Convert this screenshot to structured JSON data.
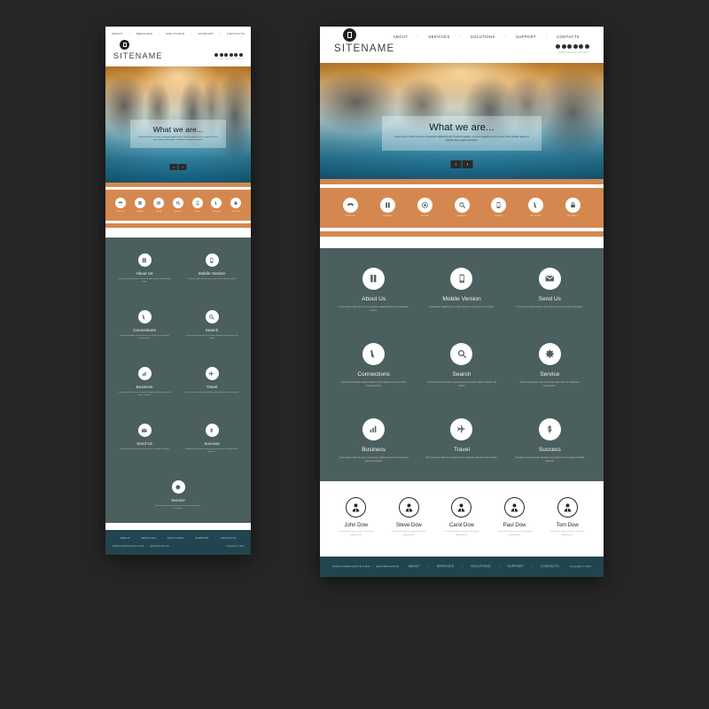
{
  "brand": {
    "name": "SITENAME",
    "logo_icon": "square-logo-icon",
    "tagline": "WEB DESIGN STUDIO"
  },
  "colors": {
    "orange": "#d4884f",
    "teal": "#4a5f5e",
    "footer": "#21454f",
    "page_bg": "#262626"
  },
  "topnav": {
    "items": [
      {
        "label": "ABOUT"
      },
      {
        "label": "SERVICES"
      },
      {
        "label": "SOLUTIONS"
      },
      {
        "label": "SUPPORT"
      },
      {
        "label": "CONTACTS"
      }
    ],
    "separator": "|"
  },
  "social": {
    "count": 6,
    "icons": [
      "facebook-icon",
      "twitter-icon",
      "google-plus-icon",
      "linkedin-icon",
      "pinterest-icon",
      "rss-icon"
    ]
  },
  "hero": {
    "title": "What we are...",
    "subtitle": "Lorem ipsum dolor sit amet, consectetur adipiscing elit. Praesent sagittis, urna eu egestas tempor, ipsum dolor pretium ligula, at molestie lacus ligula sed lorem.",
    "prev_label": "‹",
    "next_label": "›",
    "prev_icon": "chevron-left-icon",
    "next_icon": "chevron-right-icon"
  },
  "iconbar": {
    "items": [
      {
        "label": "SUPPORT",
        "icon": "phone-icon"
      },
      {
        "label": "LIBRARY",
        "icon": "book-icon"
      },
      {
        "label": "MEDIA",
        "icon": "disc-icon"
      },
      {
        "label": "SEARCH",
        "icon": "search-icon"
      },
      {
        "label": "MOBILE",
        "icon": "mobile-icon"
      },
      {
        "label": "NETWORK",
        "icon": "connections-icon"
      },
      {
        "label": "SECURITY",
        "icon": "lock-icon"
      }
    ]
  },
  "features": {
    "items": [
      {
        "title": "About Us",
        "icon": "book-icon",
        "desc": "Lorem ipsum dolor sit amet, consectetur adipiscing elit sed do eiusmod tempor."
      },
      {
        "title": "Mobile Version",
        "icon": "mobile-icon",
        "desc": "Consectetur adipiscing elit, quis nostrud ut enim ad minim veniam."
      },
      {
        "title": "Send Us",
        "icon": "envelope-icon",
        "desc": "Ut enim ad minim veniam, quis nostrud ut ea commodo consequat."
      },
      {
        "title": "Connections",
        "icon": "connections-icon",
        "desc": "Nostrud exercitation ullamco laboris nisi ut aliquip ex ea commodo consequat duis."
      },
      {
        "title": "Search",
        "icon": "search-icon",
        "desc": "Ut enim ad minim veniam, quis nostrud exercitation ullamco laboris nisi aliquip."
      },
      {
        "title": "Service",
        "icon": "gear-icon",
        "desc": "Sed ut perspiciatis unde omnis iste natus error sit voluptatem accusantium."
      },
      {
        "title": "Business",
        "icon": "chart-icon",
        "desc": "Lorem ipsum dolor sit amet, consectetur adipiscing elit sed do eiusmod tempor incididunt."
      },
      {
        "title": "Travel",
        "icon": "plane-icon",
        "desc": "Duis aute irure dolor in reprehenderit in voluptate velit esse cillum dolore."
      },
      {
        "title": "Success",
        "icon": "dollar-icon",
        "desc": "Excepteur sint occaecat cupidatat non proident sunt in culpa qui officia deserunt."
      }
    ]
  },
  "team": {
    "members": [
      {
        "name": "John Dow",
        "avatar_icon": "person-icon",
        "desc": "Lorem ipsum dolor sit amet, consectetur adipiscing elit."
      },
      {
        "name": "Steve Dow",
        "avatar_icon": "person-icon",
        "desc": "Lorem ipsum dolor sit amet, consectetur adipiscing elit."
      },
      {
        "name": "Carol Dow",
        "avatar_icon": "person-icon",
        "desc": "Lorem ipsum dolor sit amet, consectetur adipiscing elit."
      },
      {
        "name": "Paul Dow",
        "avatar_icon": "person-icon",
        "desc": "Lorem ipsum dolor sit amet, consectetur adipiscing elit."
      },
      {
        "name": "Tom Dow",
        "avatar_icon": "person-icon",
        "desc": "Lorem ipsum dolor sit amet, consectetur adipiscing elit."
      }
    ]
  },
  "footer": {
    "nav": [
      {
        "label": "ABOUT"
      },
      {
        "label": "SERVICES"
      },
      {
        "label": "SOLUTIONS"
      },
      {
        "label": "SUPPORT"
      },
      {
        "label": "CONTACTS"
      }
    ],
    "separator": "|",
    "site_url": "WWW.SAMPLESITE.COM",
    "site_handle": "@SAMPLESITE",
    "url_separator": "|",
    "copyright": "Copyright © 2013"
  }
}
